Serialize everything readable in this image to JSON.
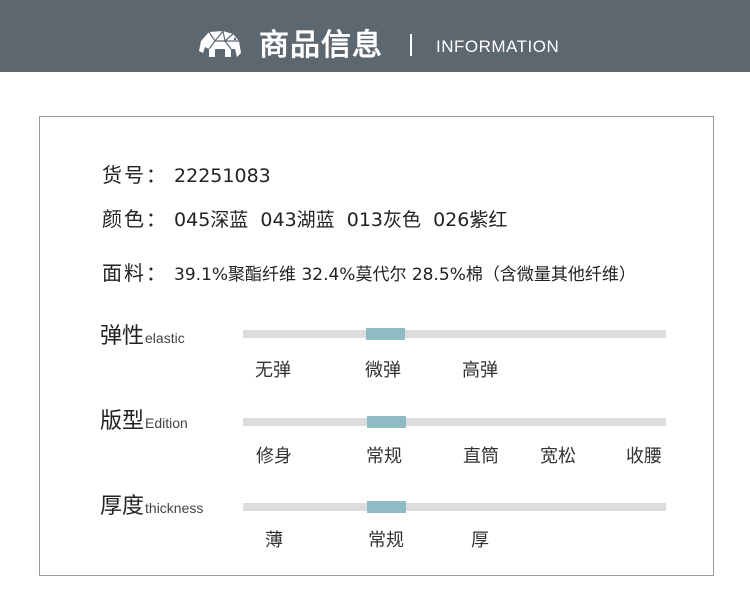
{
  "header": {
    "title": "商品信息",
    "subtitle": "INFORMATION",
    "logo_icon": "elephant-icon",
    "background": "#5d6770"
  },
  "info": {
    "item_no": {
      "label": "货号：",
      "value": "22251083"
    },
    "colors": {
      "label": "颜色：",
      "value": "045深蓝  043湖蓝  013灰色  026紫红"
    },
    "fabric": {
      "label": "面料：",
      "value": "39.1%聚酯纤维 32.4%莫代尔 28.5%棉（含微量其他纤维）"
    }
  },
  "attributes": [
    {
      "label": "弹性",
      "label_en": "elastic",
      "options": [
        "无弹",
        "微弹",
        "高弹"
      ],
      "selected": "微弹"
    },
    {
      "label": "版型",
      "label_en": "Edition",
      "options": [
        "修身",
        "常规",
        "直筒",
        "宽松",
        "收腰"
      ],
      "selected": "常规"
    },
    {
      "label": "厚度",
      "label_en": "thickness",
      "options": [
        "薄",
        "常规",
        "厚"
      ],
      "selected": "常规"
    }
  ],
  "colors": {
    "track": "#dcdcdc",
    "marker": "#8fbcc4",
    "border": "#9a9a9a"
  }
}
